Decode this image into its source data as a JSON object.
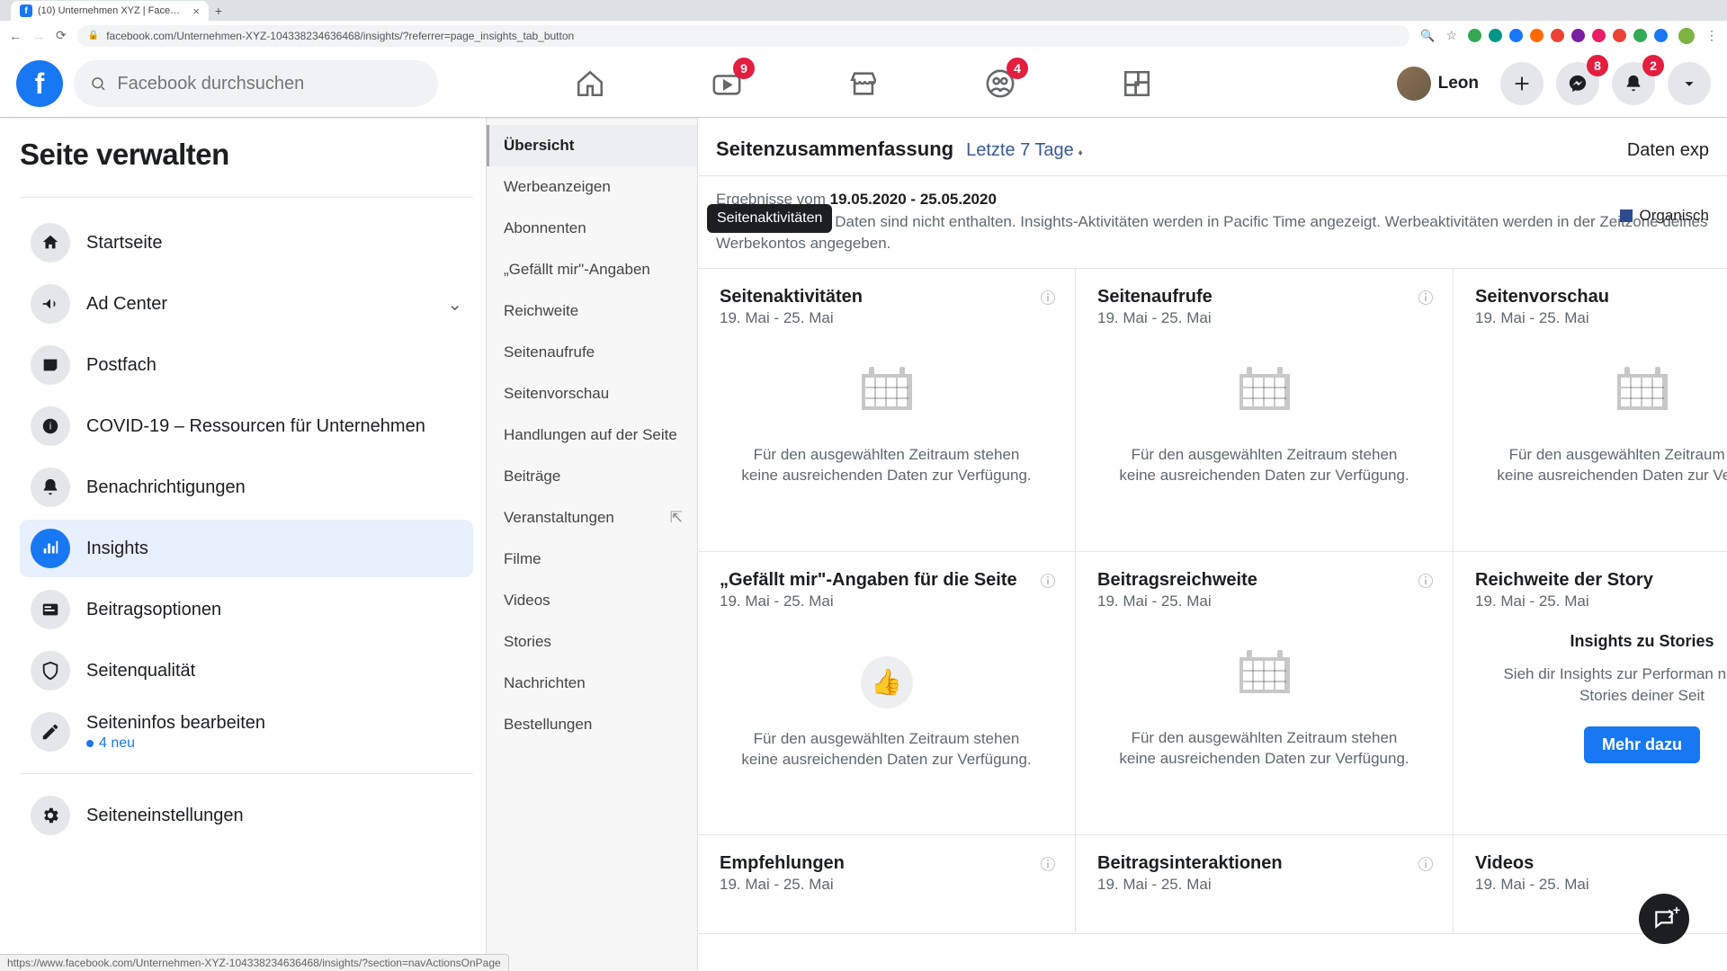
{
  "browser": {
    "tab_title": "(10) Unternehmen XYZ | Face…",
    "url": "facebook.com/Unternehmen-XYZ-104338234636468/insights/?referrer=page_insights_tab_button",
    "status_url": "https://www.facebook.com/Unternehmen-XYZ-104338234636468/insights/?section=navActionsOnPage"
  },
  "header": {
    "search_placeholder": "Facebook durchsuchen",
    "user_name": "Leon",
    "badges": {
      "watch": "9",
      "groups": "4",
      "messenger": "8",
      "notifications": "2"
    }
  },
  "left_rail": {
    "title": "Seite verwalten",
    "items": [
      {
        "id": "home",
        "label": "Startseite"
      },
      {
        "id": "adcenter",
        "label": "Ad Center",
        "chevron": true
      },
      {
        "id": "inbox",
        "label": "Postfach"
      },
      {
        "id": "covid",
        "label": "COVID-19 – Ressourcen für Unternehmen"
      },
      {
        "id": "notifs",
        "label": "Benachrichtigungen"
      },
      {
        "id": "insights",
        "label": "Insights",
        "active": true
      },
      {
        "id": "postopts",
        "label": "Beitragsoptionen"
      },
      {
        "id": "quality",
        "label": "Seitenqualität"
      },
      {
        "id": "editinfo",
        "label": "Seiteninfos bearbeiten",
        "sub": "4 neu"
      },
      {
        "id": "settings",
        "label": "Seiteneinstellungen"
      }
    ]
  },
  "sub_nav": {
    "items": [
      {
        "label": "Übersicht",
        "active": true
      },
      {
        "label": "Werbeanzeigen"
      },
      {
        "label": "Abonnenten"
      },
      {
        "label": "„Gefällt mir\"-Angaben"
      },
      {
        "label": "Reichweite"
      },
      {
        "label": "Seitenaufrufe"
      },
      {
        "label": "Seitenvorschau"
      },
      {
        "label": "Handlungen auf der Seite"
      },
      {
        "label": "Beiträge"
      },
      {
        "label": "Veranstaltungen",
        "ext": true
      },
      {
        "label": "Filme"
      },
      {
        "label": "Videos"
      },
      {
        "label": "Stories"
      },
      {
        "label": "Nachrichten"
      },
      {
        "label": "Bestellungen"
      }
    ]
  },
  "content": {
    "title": "Seitenzusammenfassung",
    "range": "Letzte 7 Tage",
    "export": "Daten exp",
    "results_prefix": "Ergebnisse vom ",
    "results_range": "19.05.2020 - 25.05.2020",
    "hint": "Hinweis: Heutige Daten sind nicht enthalten. Insights-Aktivitäten werden in Pacific Time angezeigt. Werbeaktivitäten werden in der Zeitzone deines Werbekontos angegeben.",
    "legend_label": "Organisch",
    "tooltip": "Seitenaktivitäten",
    "no_data": "Für den ausgewählten Zeitraum stehen keine ausreichenden Daten zur Verfügung.",
    "date_sub": "19. Mai - 25. Mai",
    "cards_row1": [
      {
        "title": "Seitenaktivitäten"
      },
      {
        "title": "Seitenaufrufe"
      },
      {
        "title": "Seitenvorschau"
      }
    ],
    "cards_row2": [
      {
        "title": "„Gefällt mir\"-Angaben für die Seite",
        "kind": "thumb"
      },
      {
        "title": "Beitragsreichweite",
        "kind": "cal"
      },
      {
        "title": "Reichweite der Story",
        "kind": "story"
      }
    ],
    "cards_row3": [
      {
        "title": "Empfehlungen"
      },
      {
        "title": "Beitragsinteraktionen"
      },
      {
        "title": "Videos"
      }
    ],
    "story": {
      "heading": "Insights zu Stories",
      "text": "Sieh dir Insights zur Performan neuesten Stories deiner Seit",
      "button": "Mehr dazu"
    }
  }
}
